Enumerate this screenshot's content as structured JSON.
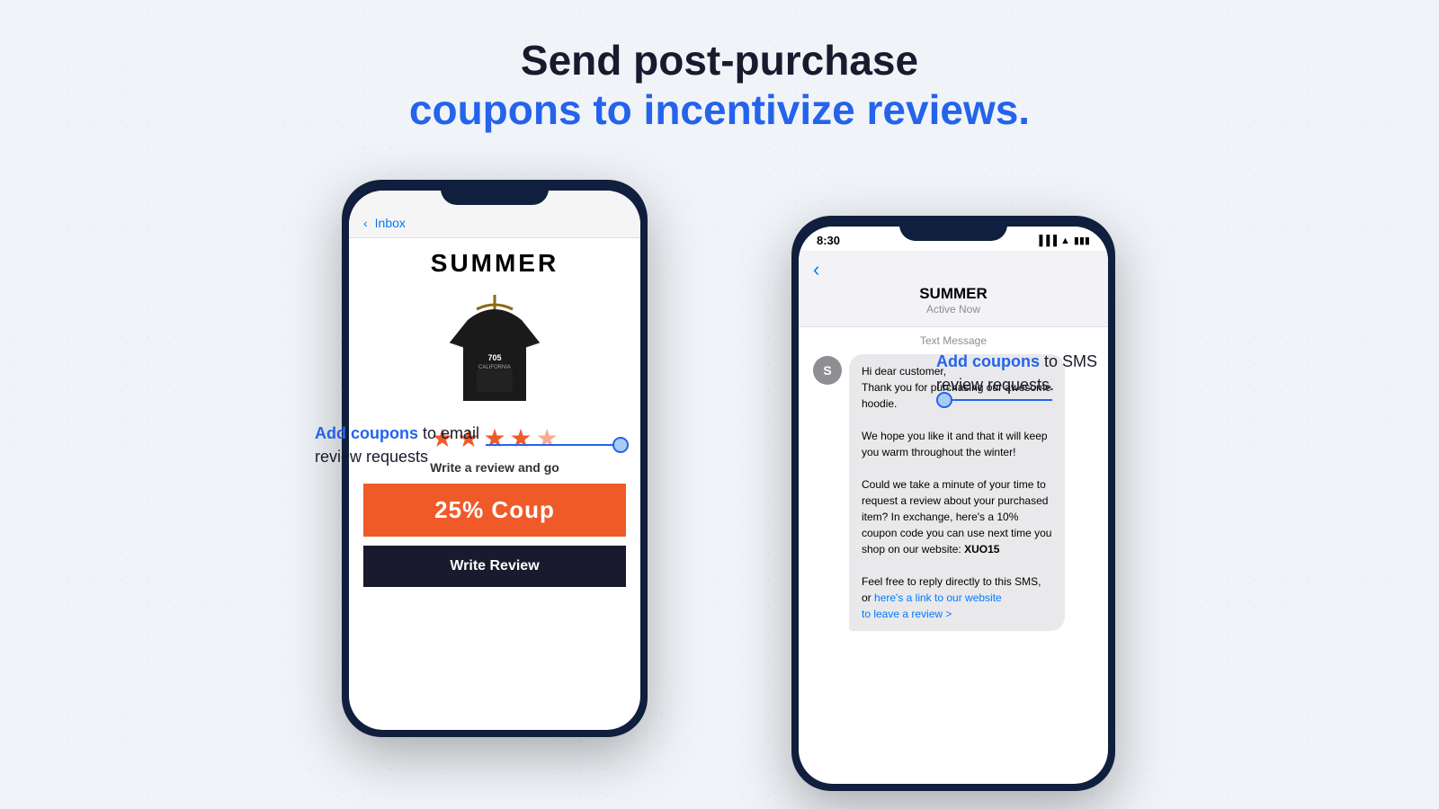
{
  "page": {
    "background_color": "#f0f4f8"
  },
  "header": {
    "line1": "Send post-purchase",
    "line2": "coupons to incentivize reviews."
  },
  "annotation_left": {
    "highlight": "Add coupons",
    "text": " to email\nreview requests"
  },
  "annotation_right": {
    "highlight": "Add coupons",
    "text": " to SMS\nreview requests."
  },
  "phone_left": {
    "type": "email",
    "inbox_label": "Inbox",
    "brand": "SUMMER",
    "stars_count": 4,
    "write_review_text": "Write a review and go",
    "coupon_text": "25%  Coup",
    "write_review_btn": "Write Review"
  },
  "phone_right": {
    "type": "sms",
    "status_time": "8:30",
    "brand": "SUMMER",
    "active_status": "Active Now",
    "section_label": "Text Message",
    "avatar_letter": "S",
    "message_lines": [
      "Hi dear customer,",
      "Thank you for purchasing our awesome hoodie.",
      "",
      "We hope you like it and that it will keep you warm throughout the winter!",
      "",
      "Could we take a minute of your time to request a review about your purchased item? In exchange, here's a 10% coupon code you can use next time you shop on our website: XUO15",
      "",
      "Feel free to reply directly to this SMS, or here's a link to our website to leave a review >"
    ],
    "coupon_code": "XUO15",
    "link_text": "here's a link to our website",
    "leave_review_text": "tO leave review >"
  }
}
